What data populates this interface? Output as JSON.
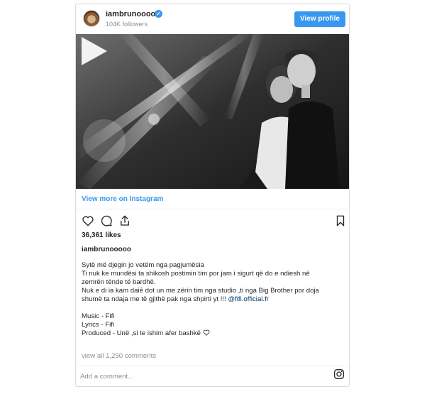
{
  "header": {
    "username": "iambrunooooo",
    "followers": "104K followers",
    "view_profile_label": "View profile"
  },
  "media": {
    "type": "video",
    "play_icon": "play-icon"
  },
  "view_more_label": "View more on Instagram",
  "actions": {
    "icons": [
      "heart-icon",
      "comment-icon",
      "share-icon",
      "bookmark-icon"
    ]
  },
  "likes": "36,361 likes",
  "owner": "iambrunooooo",
  "caption": {
    "lines": [
      "Sytë më djegin jo vetëm nga pagjumësia",
      "Ti nuk ke mundësi ta shikosh postimin tim por jam i sigurt që do e ndiesh në",
      "zemrën tënde të bardhë.",
      "Nuk e di ia kam daiē dot un me zërin tim nga studio ,ti nga Big Brother por doja",
      "shumë ta ndaja me të gjithë pak nga shpirti yt !!! "
    ],
    "mention": "@fifi.official.fr",
    "credits": [
      "Music - Fifi",
      "Lyrics - Fifi",
      "Produced - Unë ,si te ishim afer bashkë"
    ]
  },
  "view_all_comments": "view all 1,250 comments",
  "comment_placeholder": "Add a comment...",
  "colors": {
    "accent": "#3897f0",
    "text": "#262626",
    "muted": "#8e8e8e",
    "border": "#dbdbdb"
  }
}
